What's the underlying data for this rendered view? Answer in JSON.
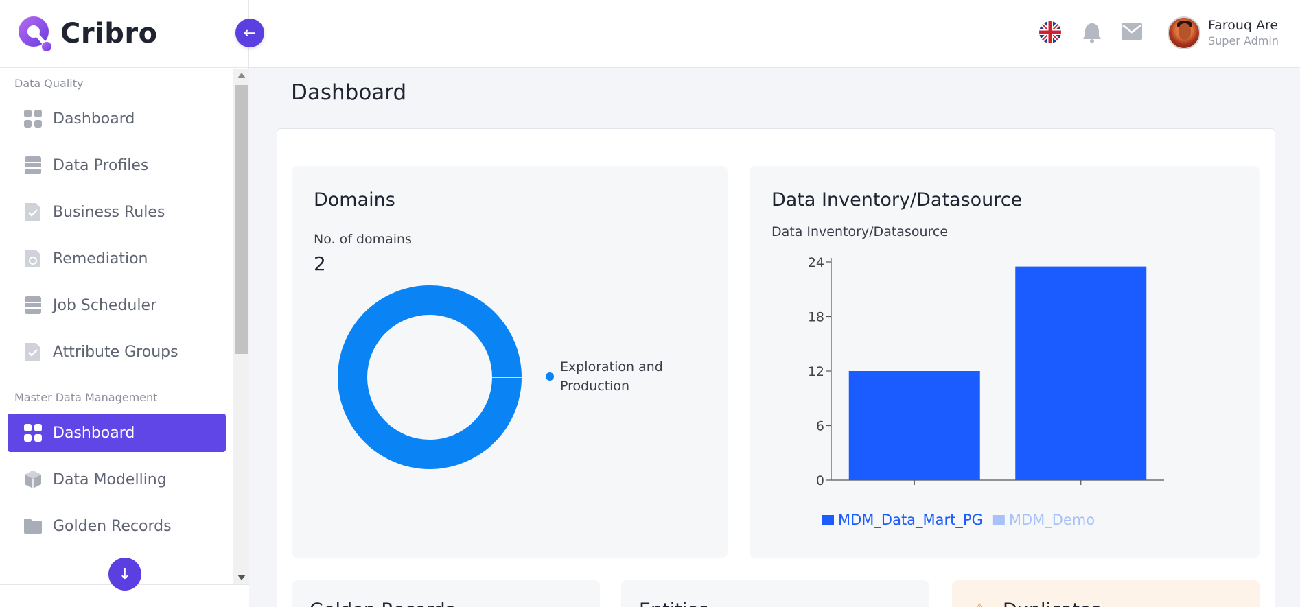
{
  "brand": {
    "name": "Cribro"
  },
  "header": {
    "user_name": "Farouq Are",
    "user_role": "Super Admin"
  },
  "sidebar": {
    "sections": [
      {
        "label": "Data Quality",
        "items": [
          {
            "label": "Dashboard",
            "icon": "grid-icon"
          },
          {
            "label": "Data Profiles",
            "icon": "table-icon"
          },
          {
            "label": "Business Rules",
            "icon": "doc-check-icon"
          },
          {
            "label": "Remediation",
            "icon": "doc-refresh-icon"
          },
          {
            "label": "Job Scheduler",
            "icon": "table-icon"
          },
          {
            "label": "Attribute Groups",
            "icon": "doc-check-icon"
          }
        ]
      },
      {
        "label": "Master Data Management",
        "items": [
          {
            "label": "Dashboard",
            "icon": "grid-icon",
            "active": true
          },
          {
            "label": "Data Modelling",
            "icon": "cube-icon"
          },
          {
            "label": "Golden Records",
            "icon": "folder-icon"
          }
        ]
      }
    ]
  },
  "page": {
    "title": "Dashboard"
  },
  "domains": {
    "title": "Domains",
    "metric_label": "No. of domains",
    "metric_value": "2",
    "legend": "Exploration and Production"
  },
  "inventory": {
    "title": "Data Inventory/Datasource",
    "subtitle": "Data Inventory/Datasource"
  },
  "bottom_panels": {
    "golden_records": "Golden Records",
    "entities": "Entities",
    "duplicates": "Duplicates"
  },
  "colors": {
    "accent": "#6046e6",
    "donut": "#0a84f5",
    "bar": "#1a5cff",
    "bar_legend_muted": "#a9c1fb"
  },
  "chart_data": [
    {
      "type": "pie",
      "title": "",
      "categories": [
        "Exploration and Production"
      ],
      "values": [
        100
      ],
      "legend_placement": "right"
    },
    {
      "type": "bar",
      "title": "",
      "categories": [
        "MDM_Data_Mart_PG",
        "MDM_Demo"
      ],
      "values": [
        12,
        23.5
      ],
      "series": [
        {
          "name": "MDM_Data_Mart_PG",
          "color": "#1a5cff"
        },
        {
          "name": "MDM_Demo",
          "color": "#a9c1fb"
        }
      ],
      "ylim": [
        0,
        24
      ],
      "yticks": [
        "0",
        "6",
        "12",
        "18",
        "24"
      ],
      "grid": false,
      "legend_placement": "bottom"
    }
  ]
}
